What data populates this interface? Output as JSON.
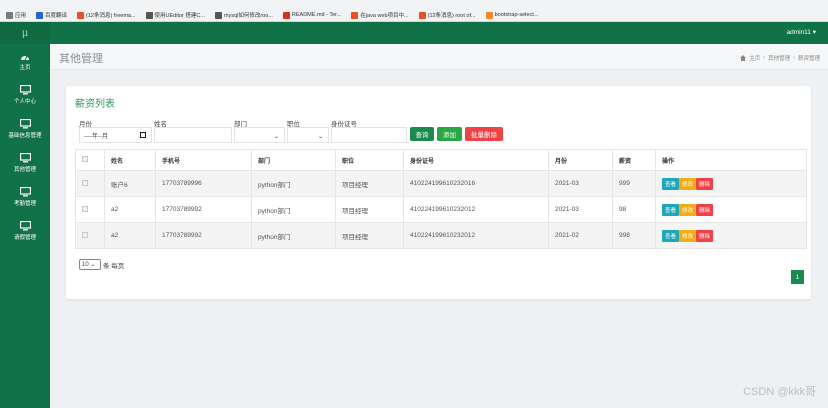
{
  "browser": {
    "bookmarks": [
      {
        "label": "应用",
        "color": "#7a7a7a"
      },
      {
        "label": "百度翻译",
        "color": "#2a62d8"
      },
      {
        "label": "(12条消息) freema...",
        "color": "#e8502b"
      },
      {
        "label": "使用UEditor 搭建C...",
        "color": "#555555"
      },
      {
        "label": "mysql如何修改roo...",
        "color": "#555555"
      },
      {
        "label": "README.md - Ter...",
        "color": "#d93025"
      },
      {
        "label": "在java web项目中...",
        "color": "#e8502b"
      },
      {
        "label": "(12条消息) root of...",
        "color": "#e8502b"
      },
      {
        "label": "bootstrap-select...",
        "color": "#f08b2c"
      }
    ]
  },
  "sidebar": {
    "logo": "μ",
    "items": [
      {
        "label": "主页"
      },
      {
        "label": "个人中心"
      },
      {
        "label": "基础信息管理"
      },
      {
        "label": "其他管理"
      },
      {
        "label": "考勤管理"
      },
      {
        "label": "请假管理"
      }
    ]
  },
  "header": {
    "user": "admin11 ▾"
  },
  "titlebar": {
    "title": "其他管理",
    "breadcrumb": [
      "主页",
      "其他管理",
      "薪资管理"
    ]
  },
  "panel": {
    "title": "薪资列表",
    "filters": {
      "month_label": "月份",
      "month_value": "----年--月",
      "name_label": "姓名",
      "dept_label": "部门",
      "position_label": "职位",
      "idcard_label": "身份证号"
    },
    "buttons": {
      "query": "查询",
      "add": "添加",
      "batch_delete": "批量删除"
    },
    "columns": [
      "",
      "姓名",
      "手机号",
      "部门",
      "职位",
      "身份证号",
      "月份",
      "薪资",
      "操作"
    ],
    "rows": [
      {
        "name": "账户6",
        "phone": "17703789996",
        "dept": "python部门",
        "position": "项目经理",
        "idcard": "410224199610232016",
        "month": "2021-03",
        "salary": "999"
      },
      {
        "name": "a2",
        "phone": "17703789992",
        "dept": "python部门",
        "position": "项目经理",
        "idcard": "410224199610232012",
        "month": "2021-03",
        "salary": "98"
      },
      {
        "name": "a2",
        "phone": "17703789992",
        "dept": "python部门",
        "position": "项目经理",
        "idcard": "410224199610232012",
        "month": "2021-02",
        "salary": "998"
      }
    ],
    "ops": {
      "view": "查看",
      "edit": "修改",
      "delete": "删除"
    },
    "pager": {
      "page_size": "10",
      "per_page_text": "条 每页",
      "current_page": "1"
    }
  },
  "watermark": "CSDN @kkk哥",
  "colors": {
    "sidebar": "#127247",
    "accent": "#2a9d5c",
    "query": "#1b8a4e",
    "add": "#27a844",
    "danger": "#ef4246"
  }
}
